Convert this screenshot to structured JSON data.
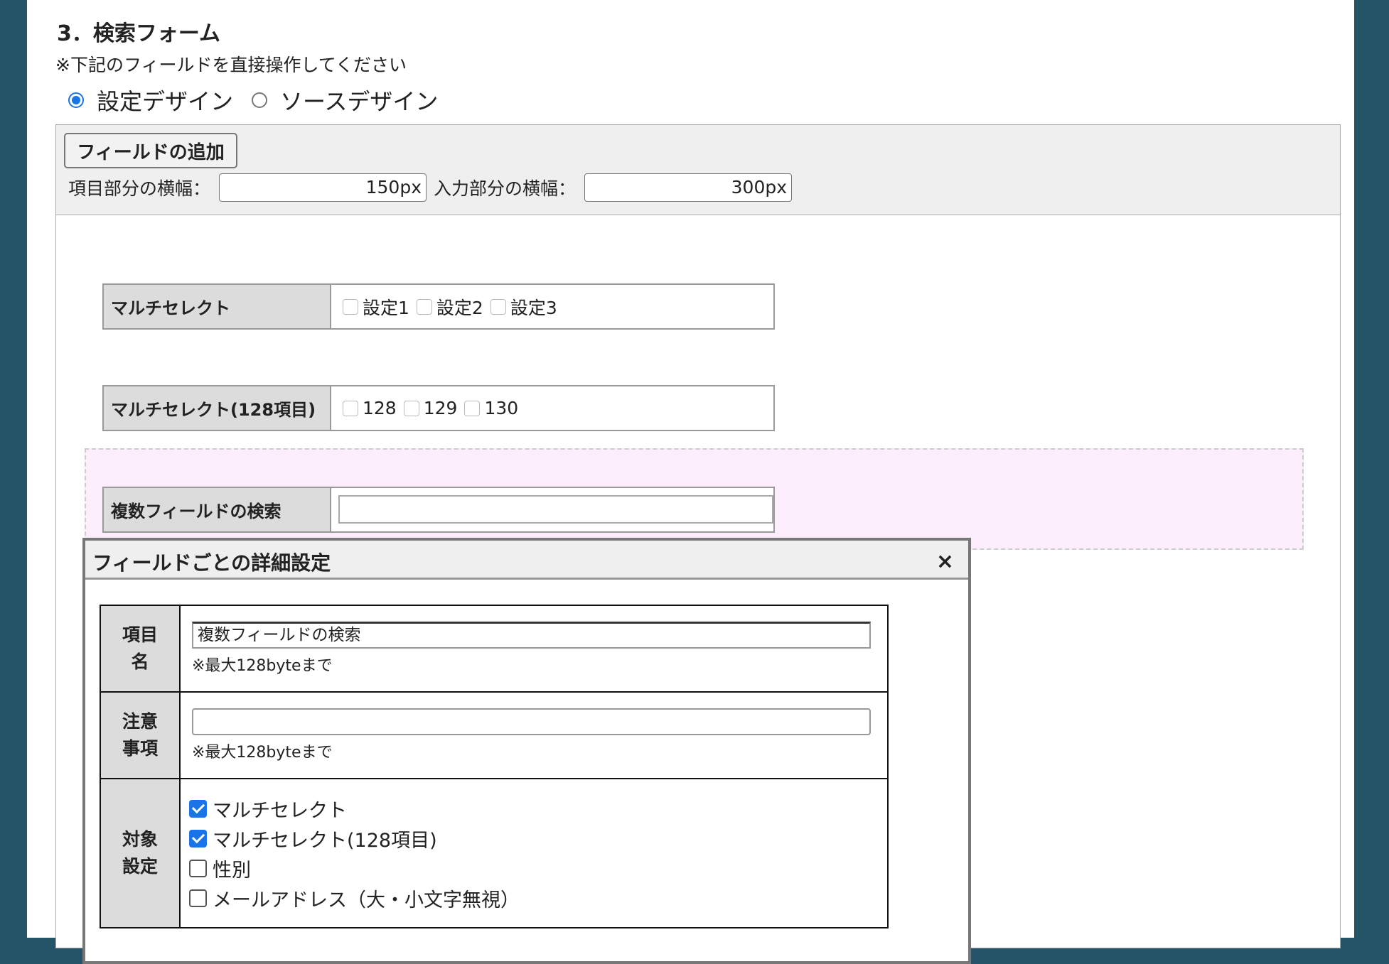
{
  "section": {
    "title": "3．検索フォーム",
    "note": "※下記のフィールドを直接操作してください"
  },
  "design_mode": {
    "options": [
      {
        "label": "設定デザイン",
        "selected": true
      },
      {
        "label": "ソースデザイン",
        "selected": false
      }
    ]
  },
  "toolbar": {
    "add_field_label": "フィールドの追加",
    "item_width_label": "項目部分の横幅：",
    "item_width_value": "150px",
    "input_width_label": "入力部分の横幅：",
    "input_width_value": "300px"
  },
  "fields": [
    {
      "label": "マルチセレクト",
      "options": [
        "設定1",
        "設定2",
        "設定3"
      ]
    },
    {
      "label": "マルチセレクト(128項目)",
      "options": [
        "128",
        "129",
        "130"
      ]
    },
    {
      "label": "複数フィールドの検索"
    }
  ],
  "dialog": {
    "title": "フィールドごとの詳細設定",
    "close_glyph": "×",
    "item_name": {
      "label_line1": "項目",
      "label_line2": "名",
      "value": "複数フィールドの検索",
      "hint": "※最大128byteまで"
    },
    "note_field": {
      "label_line1": "注意",
      "label_line2": "事項",
      "value": "",
      "hint": "※最大128byteまで"
    },
    "targets": {
      "label_line1": "対象",
      "label_line2": "設定",
      "items": [
        {
          "label": "マルチセレクト",
          "checked": true
        },
        {
          "label": "マルチセレクト(128項目)",
          "checked": true
        },
        {
          "label": "性別",
          "checked": false
        },
        {
          "label": "メールアドレス（大・小文字無視）",
          "checked": false
        }
      ]
    }
  },
  "colors": {
    "frame": "#255469",
    "accent": "#1a73e8",
    "highlight_zone": "#fdeefd",
    "label_bg": "#dcdcdc"
  }
}
